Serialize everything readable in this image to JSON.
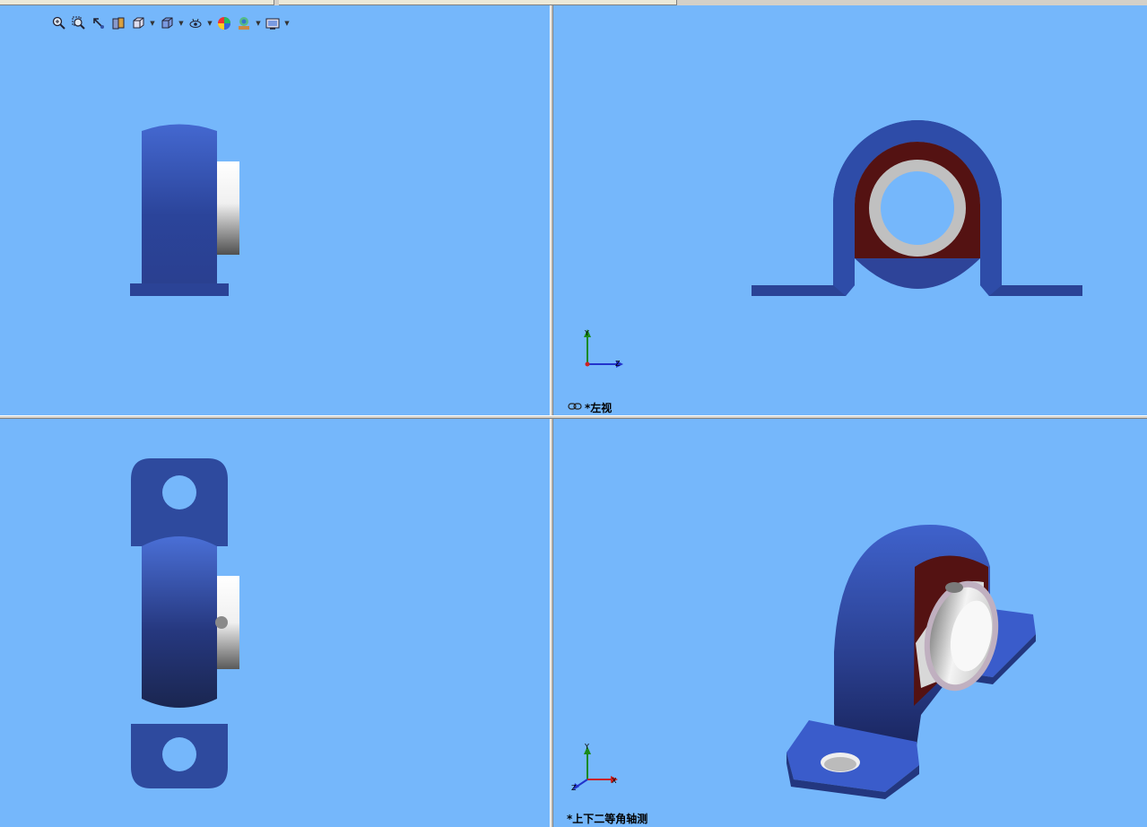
{
  "window": {
    "title": ""
  },
  "toolbar": {
    "icons": [
      {
        "name": "zoom-to-fit-icon"
      },
      {
        "name": "zoom-area-icon"
      },
      {
        "name": "previous-view-icon"
      },
      {
        "name": "section-view-icon"
      },
      {
        "name": "view-orientation-icon",
        "dropdown": true
      },
      {
        "name": "display-style-icon",
        "dropdown": true
      },
      {
        "name": "hide-show-items-icon",
        "dropdown": true
      },
      {
        "name": "edit-appearance-icon"
      },
      {
        "name": "apply-scene-icon",
        "dropdown": true
      },
      {
        "name": "view-settings-icon",
        "dropdown": true
      }
    ]
  },
  "viewports": {
    "top_left": {
      "label": ""
    },
    "top_right": {
      "label": "*左视",
      "link_icon": "link-icon"
    },
    "bottom_left": {
      "label": ""
    },
    "bottom_right": {
      "label": "*上下二等角轴测"
    }
  },
  "triad_top_right": {
    "axes": [
      "Y",
      "Z"
    ]
  },
  "triad_bottom_right": {
    "axes": [
      "Y",
      "X",
      "Z"
    ]
  },
  "colors": {
    "background": "#75b7fb",
    "housing": "#3a5bc0",
    "housing_dark": "#1e2c6a",
    "bearing_inner": "#5a0e0e",
    "ring": "#c0c0c0"
  }
}
